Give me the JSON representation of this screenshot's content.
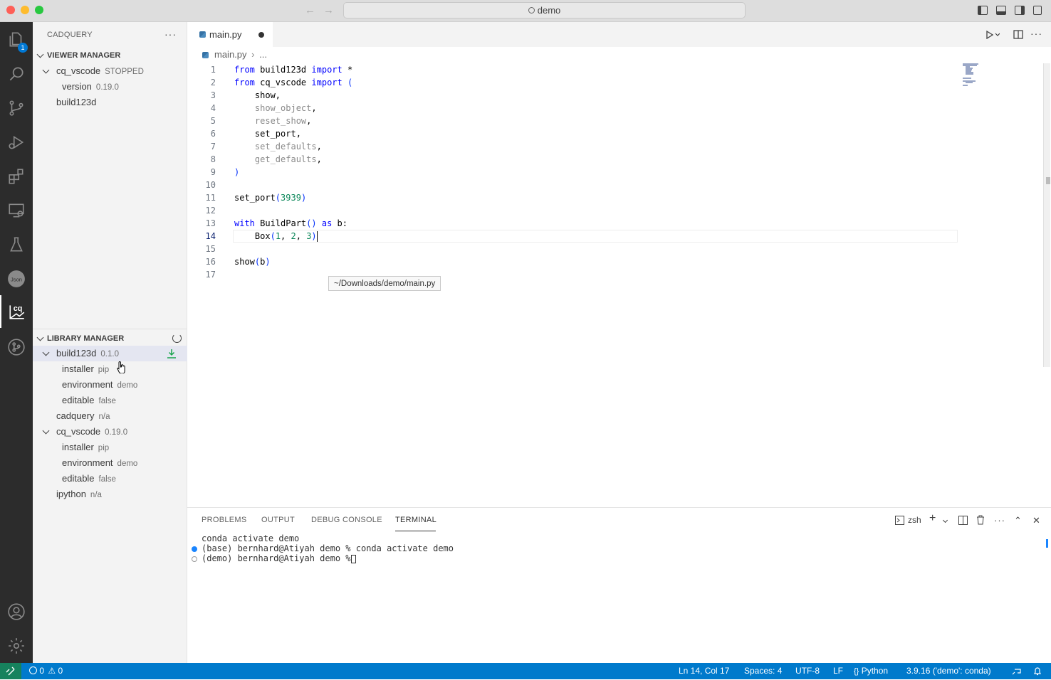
{
  "window": {
    "title": "demo"
  },
  "sidebar": {
    "title": "CADQUERY",
    "viewer_manager": {
      "heading": "VIEWER MANAGER",
      "items": [
        {
          "label": "cq_vscode",
          "desc": "STOPPED"
        },
        {
          "label": "version",
          "desc": "0.19.0"
        },
        {
          "label": "build123d",
          "desc": ""
        }
      ]
    },
    "library_manager": {
      "heading": "LIBRARY MANAGER",
      "items": [
        {
          "label": "build123d",
          "desc": "0.1.0"
        },
        {
          "label": "installer",
          "desc": "pip"
        },
        {
          "label": "environment",
          "desc": "demo"
        },
        {
          "label": "editable",
          "desc": "false"
        },
        {
          "label": "cadquery",
          "desc": "n/a"
        },
        {
          "label": "cq_vscode",
          "desc": "0.19.0"
        },
        {
          "label": "installer",
          "desc": "pip"
        },
        {
          "label": "environment",
          "desc": "demo"
        },
        {
          "label": "editable",
          "desc": "false"
        },
        {
          "label": "ipython",
          "desc": "n/a"
        }
      ]
    }
  },
  "activity_bar": {
    "explorer_badge": "1",
    "icons": [
      "files-icon",
      "search-icon",
      "source-control-icon",
      "run-debug-icon",
      "extensions-icon",
      "remote-explorer-icon",
      "testing-icon",
      "json-icon",
      "cadquery-icon",
      "git-graph-icon",
      "account-icon",
      "settings-gear-icon"
    ],
    "json_label": "Json",
    "cq_label": "cq"
  },
  "editor": {
    "tab_label": "main.py",
    "breadcrumb_file": "main.py",
    "breadcrumb_rest": "...",
    "tooltip": "~/Downloads/demo/main.py",
    "current_line": 14,
    "lines": [
      "from build123d import *",
      "from cq_vscode import (",
      "    show,",
      "    show_object,",
      "    reset_show,",
      "    set_port,",
      "    set_defaults,",
      "    get_defaults,",
      ")",
      "",
      "set_port(3939)",
      "",
      "with BuildPart() as b:",
      "    Box(1, 2, 3)",
      "",
      "show(b)",
      ""
    ]
  },
  "panel": {
    "tabs": [
      "PROBLEMS",
      "OUTPUT",
      "DEBUG CONSOLE",
      "TERMINAL"
    ],
    "active_tab": "TERMINAL",
    "shell": "zsh",
    "terminal_lines": [
      "conda activate demo",
      "(base) bernhard@Atiyah demo % conda activate demo",
      "(demo) bernhard@Atiyah demo % "
    ]
  },
  "statusbar": {
    "errors": "0",
    "warnings": "0",
    "position": "Ln 14, Col 17",
    "spaces": "Spaces: 4",
    "encoding": "UTF-8",
    "eol": "LF",
    "language": "Python",
    "interpreter": "3.9.16 ('demo': conda)"
  },
  "colors": {
    "accent": "#007acc",
    "remote": "#16825d",
    "activity_bar": "#2c2c2c"
  }
}
